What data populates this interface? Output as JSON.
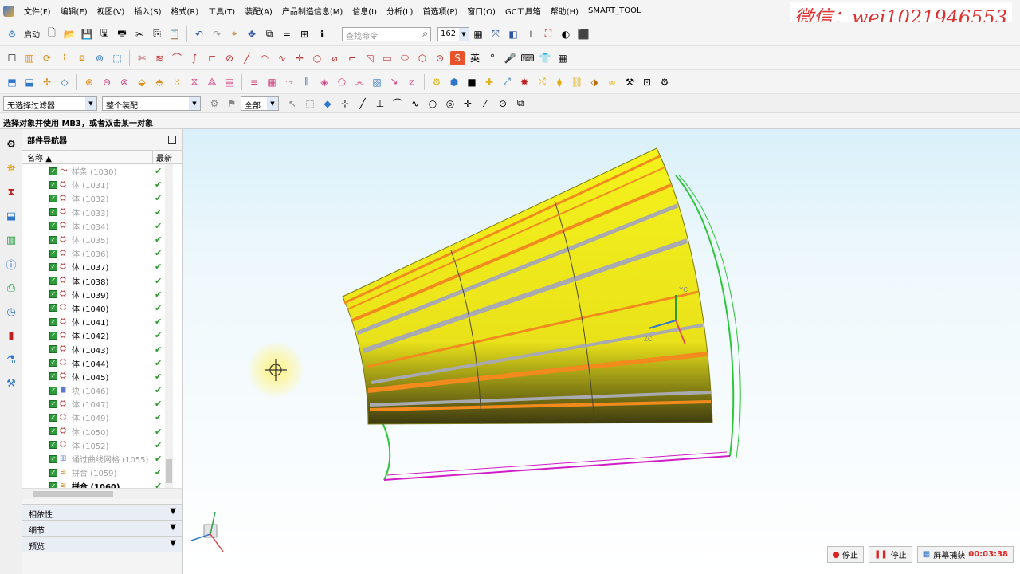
{
  "menubar": {
    "items": [
      "文件(F)",
      "编辑(E)",
      "视图(V)",
      "插入(S)",
      "格式(R)",
      "工具(T)",
      "装配(A)",
      "产品制造信息(M)",
      "信息(I)",
      "分析(L)",
      "首选项(P)",
      "窗口(O)",
      "GC工具箱",
      "帮助(H)",
      "SMART_TOOL"
    ],
    "watermark": "微信：wei1021946553"
  },
  "toolbar": {
    "start_label": "启动",
    "search_placeholder": "查找命令",
    "zoom_value": "162"
  },
  "filterbar": {
    "filter_value": "无选择过滤器",
    "assembly_scope": "整个装配",
    "layer_scope": "全部"
  },
  "cue_line": "选择对象并使用 MB3，或者双击某一对象",
  "navigator": {
    "title": "部件导航器",
    "col_name": "名称",
    "col_latest": "最新",
    "rows": [
      {
        "label": "样条 (1030)",
        "dim": true,
        "bold": false,
        "icon": "spline"
      },
      {
        "label": "体 (1031)",
        "dim": true,
        "bold": false,
        "icon": "body"
      },
      {
        "label": "体 (1032)",
        "dim": true,
        "bold": false,
        "icon": "body"
      },
      {
        "label": "体 (1033)",
        "dim": true,
        "bold": false,
        "icon": "body"
      },
      {
        "label": "体 (1034)",
        "dim": true,
        "bold": false,
        "icon": "body"
      },
      {
        "label": "体 (1035)",
        "dim": true,
        "bold": false,
        "icon": "body"
      },
      {
        "label": "体 (1036)",
        "dim": true,
        "bold": false,
        "icon": "body"
      },
      {
        "label": "体 (1037)",
        "dim": false,
        "bold": false,
        "icon": "body"
      },
      {
        "label": "体 (1038)",
        "dim": false,
        "bold": false,
        "icon": "body"
      },
      {
        "label": "体 (1039)",
        "dim": false,
        "bold": false,
        "icon": "body"
      },
      {
        "label": "体 (1040)",
        "dim": false,
        "bold": false,
        "icon": "body"
      },
      {
        "label": "体 (1041)",
        "dim": false,
        "bold": false,
        "icon": "body"
      },
      {
        "label": "体 (1042)",
        "dim": false,
        "bold": false,
        "icon": "body"
      },
      {
        "label": "体 (1043)",
        "dim": false,
        "bold": false,
        "icon": "body"
      },
      {
        "label": "体 (1044)",
        "dim": false,
        "bold": false,
        "icon": "body"
      },
      {
        "label": "体 (1045)",
        "dim": false,
        "bold": false,
        "icon": "body"
      },
      {
        "label": "块 (1046)",
        "dim": true,
        "bold": false,
        "icon": "block"
      },
      {
        "label": "体 (1047)",
        "dim": true,
        "bold": false,
        "icon": "body"
      },
      {
        "label": "体 (1049)",
        "dim": true,
        "bold": false,
        "icon": "body"
      },
      {
        "label": "体 (1050)",
        "dim": true,
        "bold": false,
        "icon": "body"
      },
      {
        "label": "体 (1052)",
        "dim": true,
        "bold": false,
        "icon": "body"
      },
      {
        "label": "通过曲线网格 (1055)",
        "dim": true,
        "bold": false,
        "icon": "mesh"
      },
      {
        "label": "拼合 (1059)",
        "dim": true,
        "bold": false,
        "icon": "sew"
      },
      {
        "label": "拼合 (1060)",
        "dim": false,
        "bold": true,
        "icon": "sew"
      }
    ],
    "panels": [
      "相依性",
      "细节",
      "预览"
    ]
  },
  "viewport": {
    "axis_labels": [
      "YC",
      "ZC"
    ]
  },
  "status": {
    "stop1": "停止",
    "stop2": "停止",
    "capture": "屏幕捕获",
    "timer": "00:03:38"
  },
  "colors": {
    "surface_yellow": "#f2ee18",
    "stripe_orange": "#f28a1e",
    "stripe_gray": "#a9a9b0",
    "curve_green": "#2fc53a",
    "curve_magenta": "#d21cc8",
    "check_green": "#2e9c3a"
  }
}
